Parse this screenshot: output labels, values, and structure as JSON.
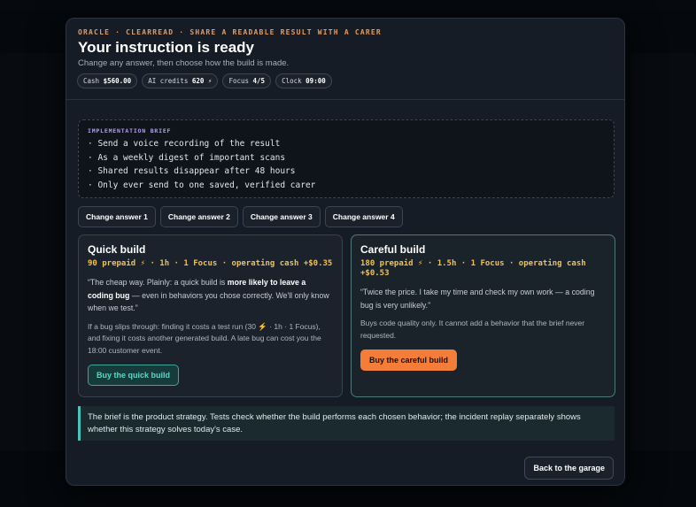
{
  "modal": {
    "eyebrow": "ORACLE · CLEARREAD · SHARE A READABLE RESULT WITH A CARER",
    "title": "Your instruction is ready",
    "subtitle": "Change any answer, then choose how the build is made.",
    "stats": [
      {
        "label": "Cash",
        "value": "$560.00"
      },
      {
        "label": "AI credits",
        "value": "620 ⚡"
      },
      {
        "label": "Focus",
        "value": "4/5"
      },
      {
        "label": "Clock",
        "value": "09:00"
      }
    ]
  },
  "brief": {
    "label": "IMPLEMENTATION BRIEF",
    "lines": [
      "· Send a voice recording of the result",
      "· As a weekly digest of important scans",
      "· Shared results disappear after 48 hours",
      "· Only ever send to one saved, verified carer"
    ]
  },
  "change_buttons": [
    "Change answer 1",
    "Change answer 2",
    "Change answer 3",
    "Change answer 4"
  ],
  "quick": {
    "title": "Quick build",
    "meta": "90 prepaid ⚡ · 1h · 1 Focus · operating cash +$0.35",
    "quote_a": "“The cheap way. Plainly: a quick build is ",
    "quote_bold": "more likely to leave a coding bug",
    "quote_b": " — even in behaviors you chose correctly. We'll only know when we test.”",
    "note": "If a bug slips through: finding it costs a test run (30 ⚡ · 1h · 1 Focus), and fixing it costs another generated build. A late bug can cost you the 18:00 customer event.",
    "button": "Buy the quick build"
  },
  "careful": {
    "title": "Careful build",
    "meta": "180 prepaid ⚡ · 1.5h · 1 Focus · operating cash +$0.53",
    "quote": "“Twice the price. I take my time and check my own work — a coding bug is very unlikely.”",
    "note": "Buys code quality only. It cannot add a behavior that the brief never requested.",
    "button": "Buy the careful build"
  },
  "callout": "The brief is the product strategy. Tests check whether the build performs each chosen behavior; the incident replay separately shows whether this strategy solves today's case.",
  "back_button": "Back to the garage",
  "colors": {
    "accent_orange": "#f57d3a",
    "accent_teal": "#49c4b7",
    "meta_yellow": "#f2c14f",
    "eyebrow_orange": "#e89a5a",
    "brief_label_purple": "#b59cf5"
  }
}
